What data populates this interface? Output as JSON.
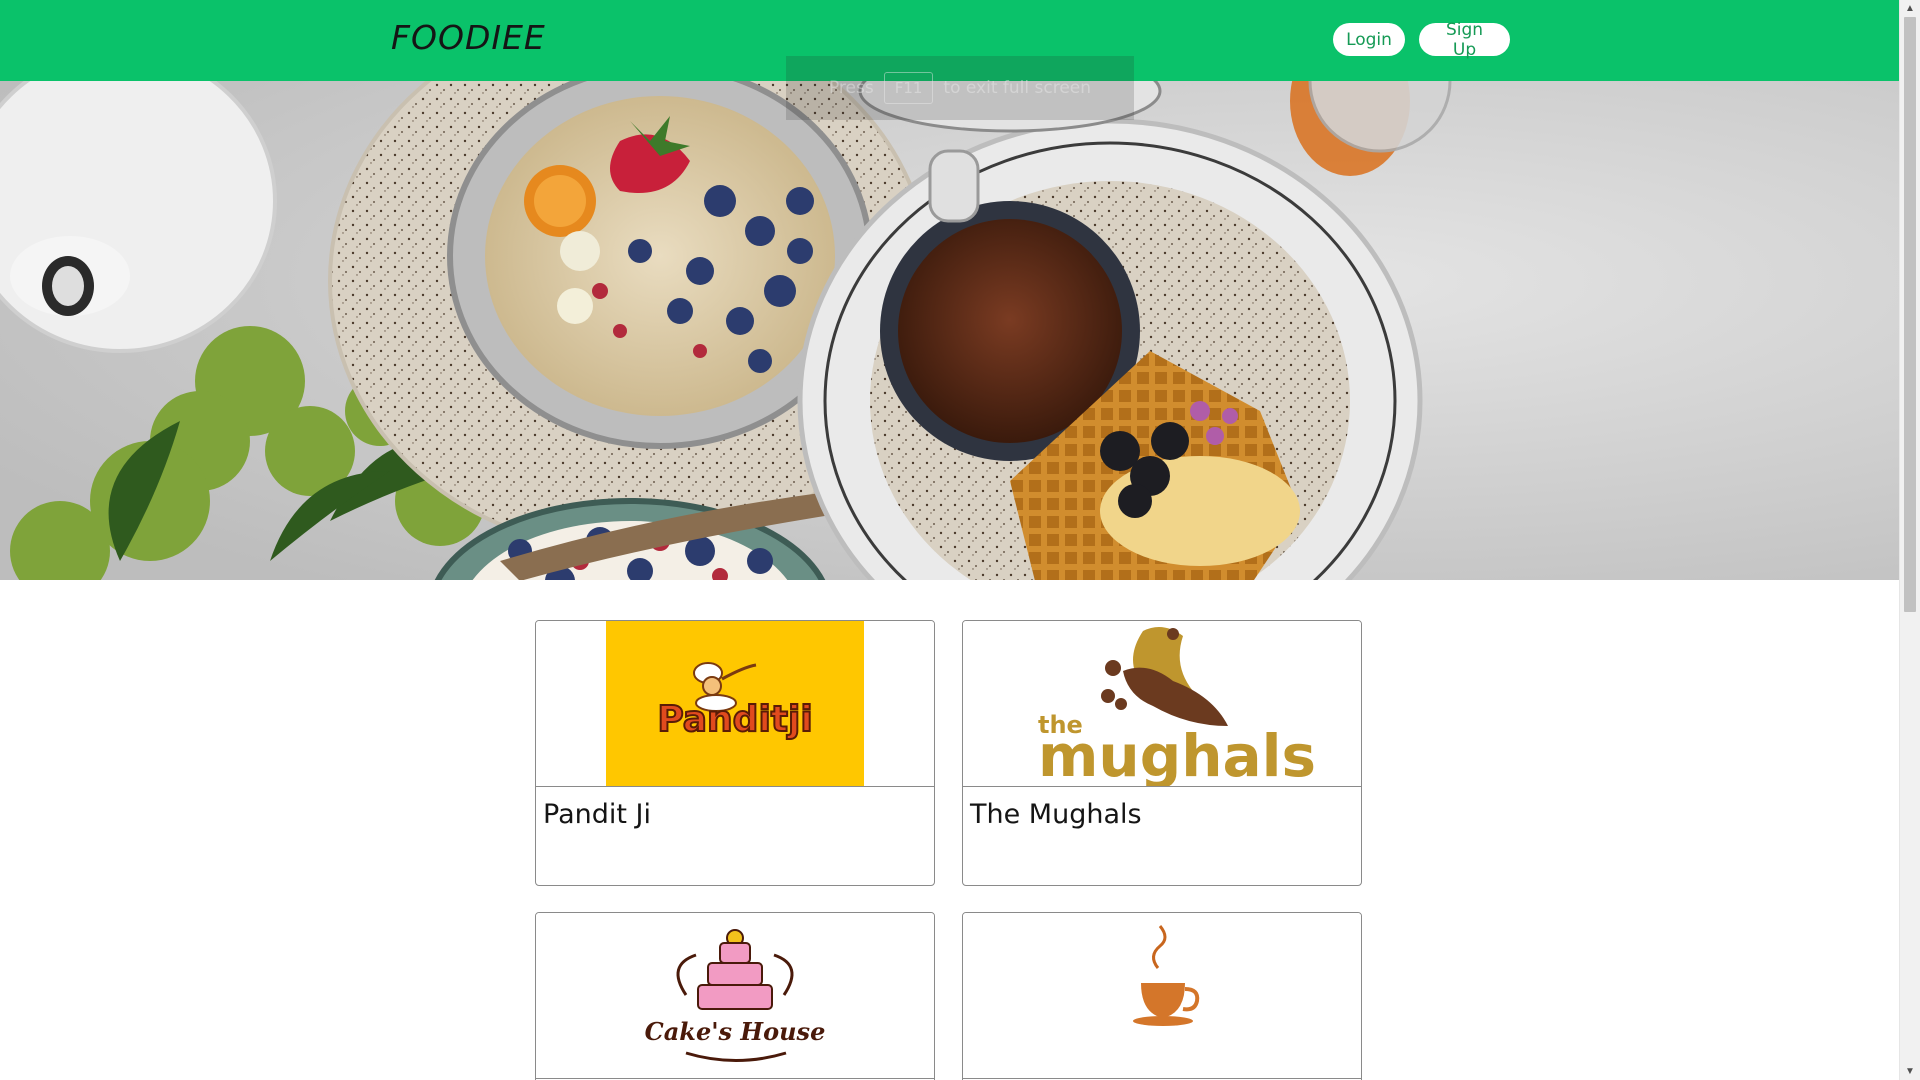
{
  "colors": {
    "brand": "#0ac26a",
    "button_text": "#159a55"
  },
  "navbar": {
    "brand_part1": "FOO",
    "brand_part2": "DIEE",
    "login_label": "Login",
    "signup_label": "Sign Up"
  },
  "fullscreen_hint": {
    "prefix": "Press",
    "key": "F11",
    "suffix": "to exit full screen"
  },
  "restaurants": [
    {
      "name": "Pandit Ji",
      "logo_text": "Panditji",
      "logo_icon": "chef-icon"
    },
    {
      "name": "The Mughals",
      "logo_text_small": "the",
      "logo_text": "mughals",
      "logo_icon": "mughal-crown-icon"
    },
    {
      "name": "",
      "logo_text": "Cake's House",
      "logo_icon": "cake-icon"
    },
    {
      "name": "",
      "logo_text": "",
      "logo_icon": "coffee-cup-icon"
    }
  ],
  "scrollbar": {
    "position_fraction": 0.0
  }
}
